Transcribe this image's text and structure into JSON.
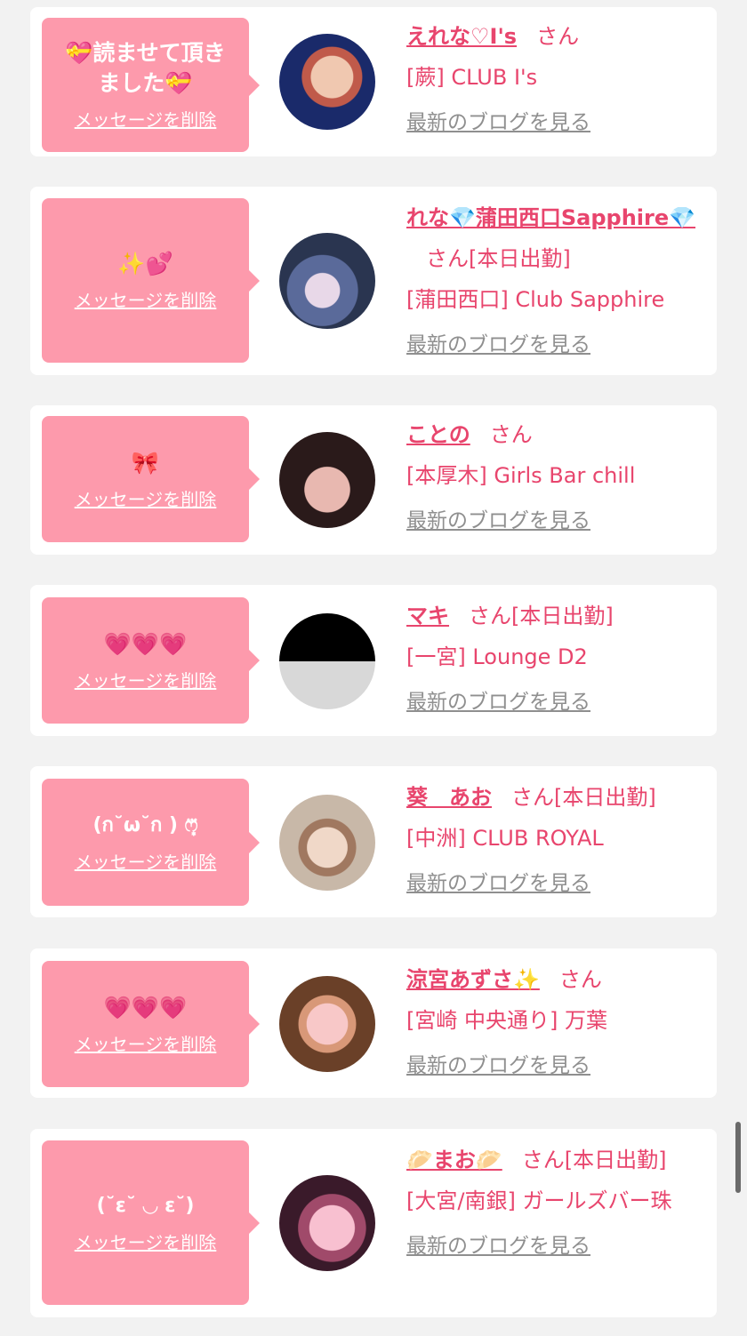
{
  "common": {
    "delete_label": "メッセージを削除",
    "blog_label": "最新のブログを見る",
    "san_label": "さん"
  },
  "cards": [
    {
      "message": "💝読ませて頂きました💝",
      "name": "えれな♡I's",
      "status": "",
      "shop": "[蕨] CLUB I's",
      "avatar_colors": [
        "#1a2a6a",
        "#f0c8b0"
      ]
    },
    {
      "message": "✨💕",
      "name": "れな💎蒲田西口Sapphire💎",
      "status": "[本日出勤]",
      "shop": "[蒲田西口] Club Sapphire",
      "avatar_colors": [
        "#3a4a6a",
        "#8fa0c8"
      ]
    },
    {
      "message": "🎀",
      "name": "ことの",
      "status": "",
      "shop": "[本厚木] Girls Bar chill",
      "avatar_colors": [
        "#3a2a2a",
        "#e8b8b0"
      ]
    },
    {
      "message": "💗💗💗",
      "name": "マキ",
      "status": "[本日出勤]",
      "shop": "[一宮] Lounge D2",
      "avatar_colors": [
        "#000000",
        "#d8d8d8"
      ]
    },
    {
      "message": "(ก˘ω˘ก ) ෆ͙⃛",
      "name": "葵　あお",
      "status": "[本日出勤]",
      "shop": "[中洲] CLUB ROYAL",
      "avatar_colors": [
        "#c8b8a8",
        "#f0d8c8"
      ]
    },
    {
      "message": "💗💗💗",
      "name": "涼宮あずさ✨",
      "status": "",
      "shop": "[宮崎 中央通り] 万葉",
      "avatar_colors": [
        "#8a5a3a",
        "#f8c8c8"
      ]
    },
    {
      "message": "(˘ε˘ ◡ ε˘)",
      "name": "🥟まお🥟",
      "status": "[本日出勤]",
      "shop": "[大宮/南銀] ガールズバー珠",
      "avatar_colors": [
        "#5a2a3a",
        "#f8c0d0"
      ]
    }
  ],
  "colors": {
    "accent": "#e8456d",
    "bubble": "#fd9aac",
    "muted": "#8f8f8f",
    "background": "#f2f2f2"
  }
}
